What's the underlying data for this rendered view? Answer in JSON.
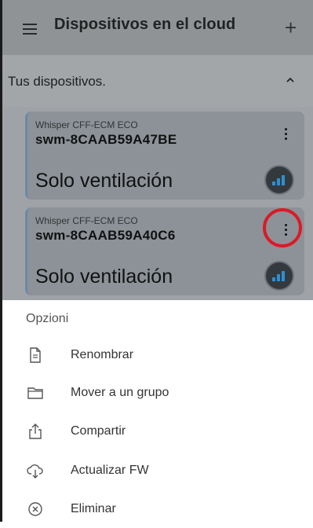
{
  "appbar": {
    "title": "Dispositivos en el cloud",
    "menu_icon": "hamburger-icon",
    "add_icon": "plus-icon"
  },
  "section": {
    "title": "Tus dispositivos.",
    "collapse_icon": "chevron-up-icon"
  },
  "devices": [
    {
      "model": "Whisper CFF-ECM ECO",
      "id": "swm-8CAAB59A47BE",
      "mode": "Solo ventilación",
      "signal_icon": "signal-strength-icon",
      "options_icon": "more-vert-icon"
    },
    {
      "model": "Whisper CFF-ECM ECO",
      "id": "swm-8CAAB59A40C6",
      "mode": "Solo ventilación",
      "signal_icon": "signal-strength-icon",
      "options_icon": "more-vert-icon",
      "highlighted": true
    }
  ],
  "options_sheet": {
    "title": "Opzioni",
    "items": [
      {
        "label": "Renombrar",
        "icon": "document-icon"
      },
      {
        "label": "Mover a un grupo",
        "icon": "folder-icon"
      },
      {
        "label": "Compartir",
        "icon": "share-icon"
      },
      {
        "label": "Actualizar FW",
        "icon": "cloud-download-icon"
      },
      {
        "label": "Eliminar",
        "icon": "cancel-circle-icon"
      }
    ]
  },
  "colors": {
    "highlight_ring": "#d91b25",
    "signal_bars": "#2e8fd0",
    "card_accent": "#6e88a5"
  }
}
